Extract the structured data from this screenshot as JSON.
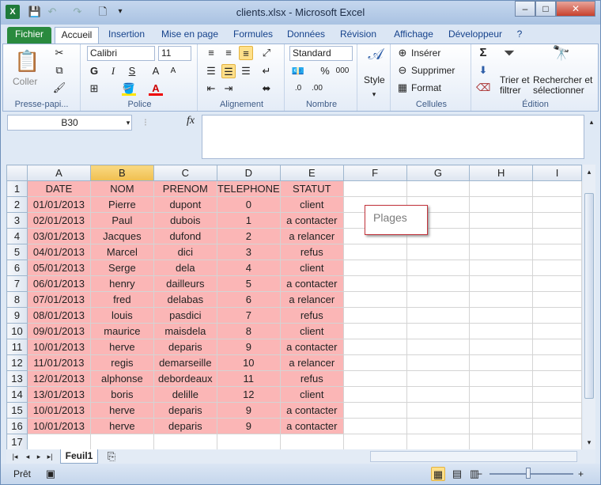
{
  "window": {
    "title": "clients.xlsx - Microsoft Excel",
    "minimize": "–",
    "maximize": "□",
    "close": "✕"
  },
  "tabs": [
    "Fichier",
    "Accueil",
    "Insertion",
    "Mise en page",
    "Formules",
    "Données",
    "Révision",
    "Affichage",
    "Développeur"
  ],
  "ribbon": {
    "clipboard": {
      "paste": "Coller",
      "label": "Presse-papi..."
    },
    "font": {
      "name": "Calibri",
      "size": "11",
      "bold": "G",
      "italic": "I",
      "underline": "S",
      "grow": "A",
      "shrink": "A",
      "label": "Police"
    },
    "alignment": {
      "label": "Alignement"
    },
    "number": {
      "format": "Standard",
      "percent": "%",
      "thousands": "000",
      "label": "Nombre"
    },
    "style": {
      "label": "Style"
    },
    "cells": {
      "insert": "Insérer",
      "delete": "Supprimer",
      "format": "Format",
      "label": "Cellules"
    },
    "editing": {
      "sum": "Σ",
      "sort_line1": "Trier et",
      "sort_line2": "filtrer",
      "find_line1": "Rechercher et",
      "find_line2": "sélectionner",
      "label": "Édition"
    }
  },
  "formula_bar": {
    "name_box": "B30",
    "fx": "fx",
    "content": ""
  },
  "columns": [
    "A",
    "B",
    "C",
    "D",
    "E",
    "F",
    "G",
    "H",
    "I"
  ],
  "selected_column": "B",
  "rows": [
    [
      "DATE",
      "NOM",
      "PRENOM",
      "TELEPHONE",
      "STATUT"
    ],
    [
      "01/01/2013",
      "Pierre",
      "dupont",
      "0",
      "client"
    ],
    [
      "02/01/2013",
      "Paul",
      "dubois",
      "1",
      "a contacter"
    ],
    [
      "03/01/2013",
      "Jacques",
      "dufond",
      "2",
      "a relancer"
    ],
    [
      "04/01/2013",
      "Marcel",
      "dici",
      "3",
      "refus"
    ],
    [
      "05/01/2013",
      "Serge",
      "dela",
      "4",
      "client"
    ],
    [
      "06/01/2013",
      "henry",
      "dailleurs",
      "5",
      "a contacter"
    ],
    [
      "07/01/2013",
      "fred",
      "delabas",
      "6",
      "a relancer"
    ],
    [
      "08/01/2013",
      "louis",
      "pasdici",
      "7",
      "refus"
    ],
    [
      "09/01/2013",
      "maurice",
      "maisdela",
      "8",
      "client"
    ],
    [
      "10/01/2013",
      "herve",
      "deparis",
      "9",
      "a contacter"
    ],
    [
      "11/01/2013",
      "regis",
      "demarseille",
      "10",
      "a relancer"
    ],
    [
      "12/01/2013",
      "alphonse",
      "debordeaux",
      "11",
      "refus"
    ],
    [
      "13/01/2013",
      "boris",
      "delille",
      "12",
      "client"
    ],
    [
      "10/01/2013",
      "herve",
      "deparis",
      "9",
      "a contacter"
    ],
    [
      "10/01/2013",
      "herve",
      "deparis",
      "9",
      "a contacter"
    ],
    [
      "",
      "",
      "",
      "",
      ""
    ]
  ],
  "comment": "Plages",
  "sheet_tab": "Feuil1",
  "status": {
    "ready": "Prêt",
    "zoom_minus": "−",
    "zoom_plus": "+"
  },
  "colors": {
    "highlight": "#fbb6b6",
    "comment_border": "#c2333b",
    "file_tab": "#2a8a3e"
  }
}
